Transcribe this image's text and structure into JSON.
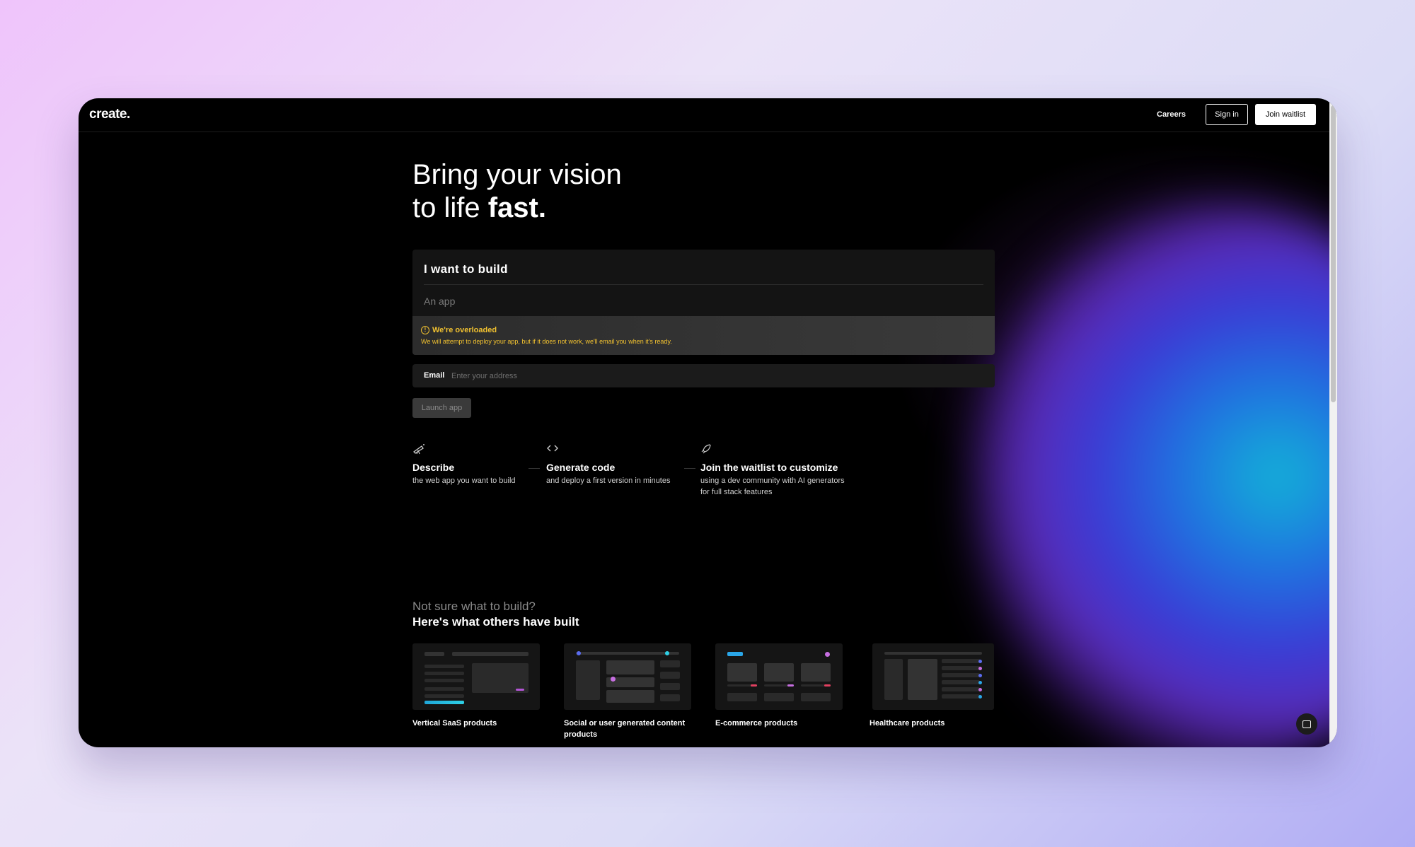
{
  "header": {
    "logo": "create.",
    "nav_careers": "Careers",
    "signin_label": "Sign in",
    "waitlist_label": "Join waitlist"
  },
  "hero": {
    "line1": "Bring your vision",
    "line2_prefix": "to life ",
    "line2_bold": "fast."
  },
  "build_form": {
    "title": "I want to build",
    "input_placeholder": "An app",
    "warning_title": "We're overloaded",
    "warning_text": "We will attempt to deploy your app, but if it does not work, we'll email you when it's ready.",
    "email_label": "Email",
    "email_placeholder": "Enter your address",
    "launch_label": "Launch app"
  },
  "steps": [
    {
      "icon": "telescope-icon",
      "title": "Describe",
      "desc": "the web app you want to build"
    },
    {
      "icon": "code-icon",
      "title": "Generate code",
      "desc": "and deploy a first version in minutes"
    },
    {
      "icon": "rocket-icon",
      "title": "Join the waitlist to customize",
      "desc": "using a dev community with AI generators for full stack features"
    }
  ],
  "examples": {
    "question": "Not sure what to build?",
    "heading": "Here's what others have built",
    "cards": [
      {
        "label": "Vertical SaaS products"
      },
      {
        "label": "Social or user generated content products"
      },
      {
        "label": "E-commerce products"
      },
      {
        "label": "Healthcare products"
      }
    ]
  },
  "colors": {
    "warning": "#f2c230",
    "glow_cyan": "#12b6d6",
    "glow_blue": "#1f74e0",
    "glow_purple": "#5a2bb8"
  }
}
